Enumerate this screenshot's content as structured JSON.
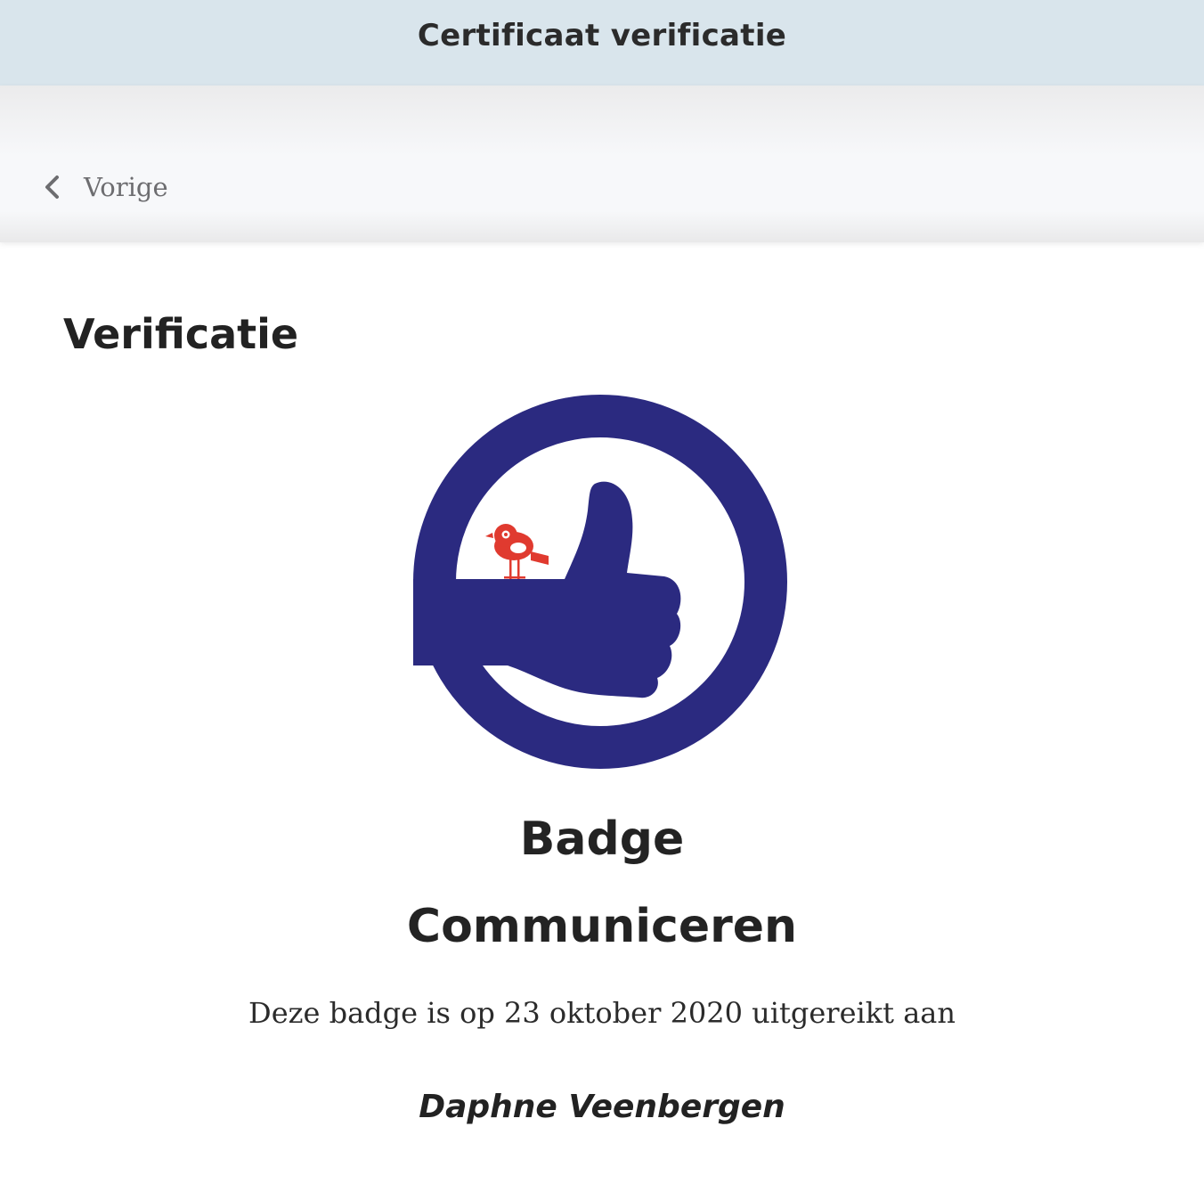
{
  "header": {
    "title": "Certificaat verificatie"
  },
  "nav": {
    "back_label": "Vorige",
    "back_icon": "chevron-left-icon"
  },
  "main": {
    "heading": "Verificatie",
    "badge": {
      "image_icon": "thumbs-up-bird-badge",
      "type": "Badge",
      "name": "Communiceren",
      "issued_text": "Deze badge is op 23 oktober 2020 uitgereikt aan",
      "recipient": "Daphne Veenbergen"
    }
  },
  "colors": {
    "header_bg": "#d9e5ec",
    "badge_blue": "#2b2a80",
    "bird_red": "#e03a2f",
    "text": "#222222",
    "muted": "#6d6d70"
  }
}
